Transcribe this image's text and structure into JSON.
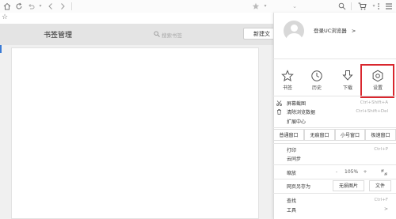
{
  "toolbar": {
    "icons": [
      "home-icon",
      "refresh-icon",
      "undo-icon",
      "back-icon",
      "forward-icon",
      "star-icon",
      "dropdown-icon",
      "search-icon",
      "cart-icon",
      "more-icon",
      "menu-icon"
    ],
    "bookmark_star": "☆"
  },
  "bookmarks_page": {
    "title": "书签管理",
    "search_placeholder": "搜索书签",
    "new_button": "新建文"
  },
  "menu": {
    "login": "登录UC浏览器",
    "login_arrow": ">",
    "quick_actions": [
      {
        "label": "书签",
        "icon": "star-icon"
      },
      {
        "label": "历史",
        "icon": "clock-icon"
      },
      {
        "label": "下载",
        "icon": "download-icon"
      },
      {
        "label": "设置",
        "icon": "gear-icon"
      }
    ],
    "items": [
      {
        "label": "屏幕截图",
        "shortcut": "Ctrl+Shift+A",
        "icon": "scissors-icon"
      },
      {
        "label": "清除浏览数据",
        "shortcut": "Ctrl+Shift+Del",
        "icon": "trash-icon"
      },
      {
        "label": "扩展中心",
        "shortcut": ""
      }
    ],
    "window_modes": [
      "普通窗口",
      "无痕窗口",
      "小号窗口",
      "极速窗口"
    ],
    "print": {
      "label": "打印",
      "shortcut": "Ctrl+P"
    },
    "sync": {
      "label": "云同步"
    },
    "zoom": {
      "label": "缩放",
      "minus": "-",
      "value": "105%",
      "plus": "+"
    },
    "save_page": {
      "label": "网页另存为",
      "image_button": "无损图片",
      "file_button": "文件"
    },
    "find": {
      "label": "查找",
      "shortcut": "Ctrl+F"
    },
    "tools": {
      "label": "工具",
      "arrow": ">"
    }
  }
}
